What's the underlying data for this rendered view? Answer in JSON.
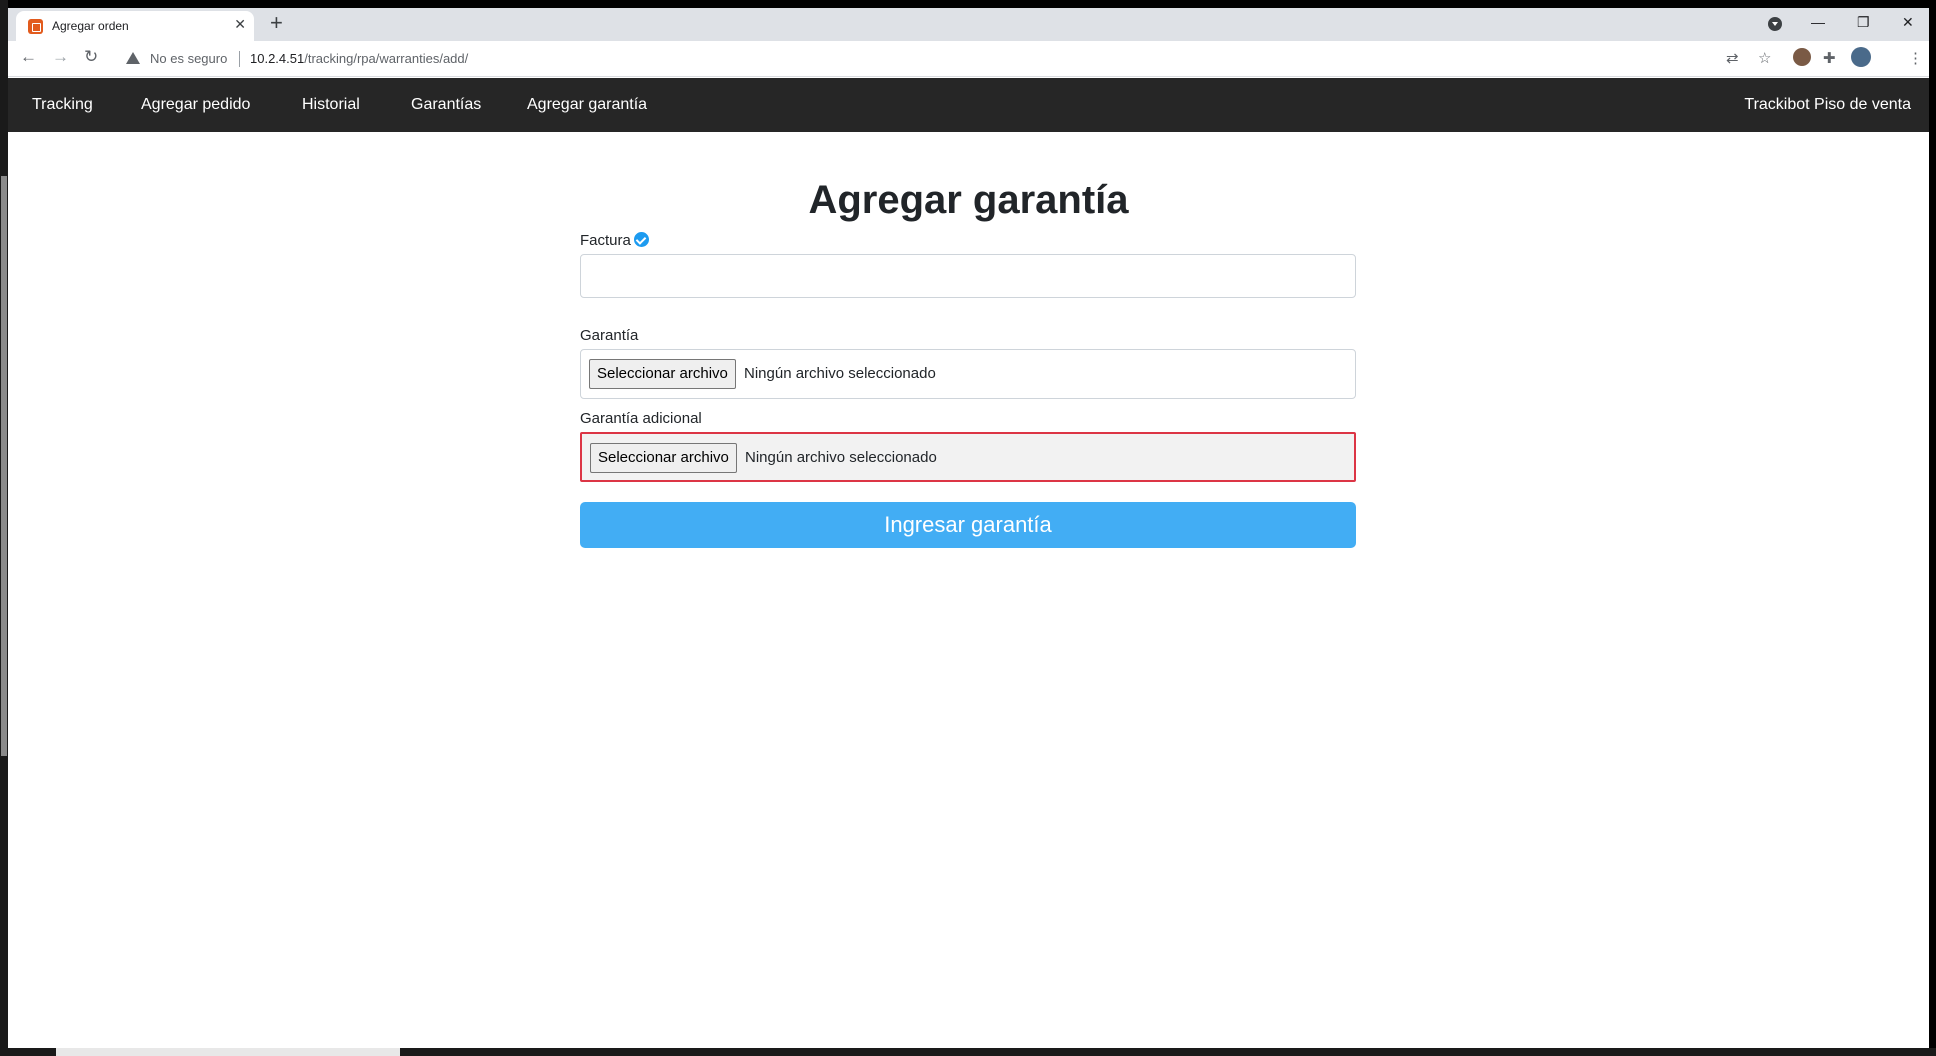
{
  "browser": {
    "tab_title": "Agregar orden",
    "tab_close": "✕",
    "new_tab": "+",
    "security_label": "No es seguro",
    "url_host": "10.2.4.51",
    "url_path": "/tracking/rpa/warranties/add/",
    "window_controls": {
      "minimize": "—",
      "restore": "❐",
      "close": "✕"
    }
  },
  "navbar": {
    "items": [
      {
        "label": "Tracking"
      },
      {
        "label": "Agregar pedido"
      },
      {
        "label": "Historial"
      },
      {
        "label": "Garantías"
      },
      {
        "label": "Agregar garantía"
      }
    ],
    "brand": "Trackibot Piso de venta"
  },
  "page": {
    "title": "Agregar garantía"
  },
  "form": {
    "factura": {
      "label": "Factura",
      "value": ""
    },
    "garantia": {
      "label": "Garantía",
      "button_label": "Seleccionar archivo",
      "status": "Ningún archivo seleccionado"
    },
    "garantia_adicional": {
      "label": "Garantía adicional",
      "button_label": "Seleccionar archivo",
      "status": "Ningún archivo seleccionado"
    },
    "submit_label": "Ingresar garantía"
  },
  "colors": {
    "navbar_bg": "#262626",
    "submit_bg": "#42adf4",
    "invalid_border": "#dc3545",
    "verified_badge": "#1d9bf0"
  }
}
